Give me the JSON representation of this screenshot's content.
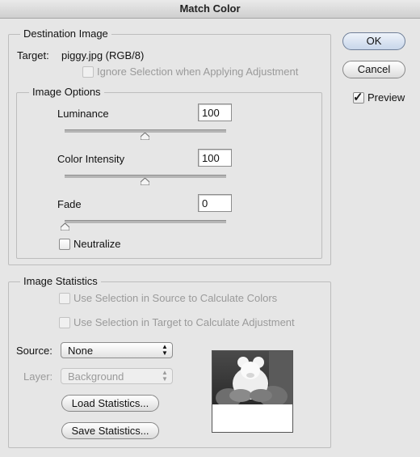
{
  "window": {
    "title": "Match Color"
  },
  "buttons": {
    "ok": "OK",
    "cancel": "Cancel",
    "preview_label": "Preview",
    "preview_checked": true
  },
  "destination": {
    "legend": "Destination Image",
    "target_label": "Target:",
    "target_value": "piggy.jpg (RGB/8)",
    "ignore_selection": "Ignore Selection when Applying Adjustment"
  },
  "image_options": {
    "legend": "Image Options",
    "luminance": {
      "label": "Luminance",
      "value": "100",
      "level": 0.5
    },
    "color_intensity": {
      "label": "Color Intensity",
      "value": "100",
      "level": 0.5
    },
    "fade": {
      "label": "Fade",
      "value": "0",
      "level": 0.0
    },
    "neutralize": "Neutralize"
  },
  "statistics": {
    "legend": "Image Statistics",
    "use_source": "Use Selection in Source to Calculate Colors",
    "use_target": "Use Selection in Target to Calculate Adjustment",
    "source_label": "Source:",
    "source_value": "None",
    "layer_label": "Layer:",
    "layer_value": "Background",
    "load": "Load Statistics...",
    "save": "Save Statistics..."
  }
}
